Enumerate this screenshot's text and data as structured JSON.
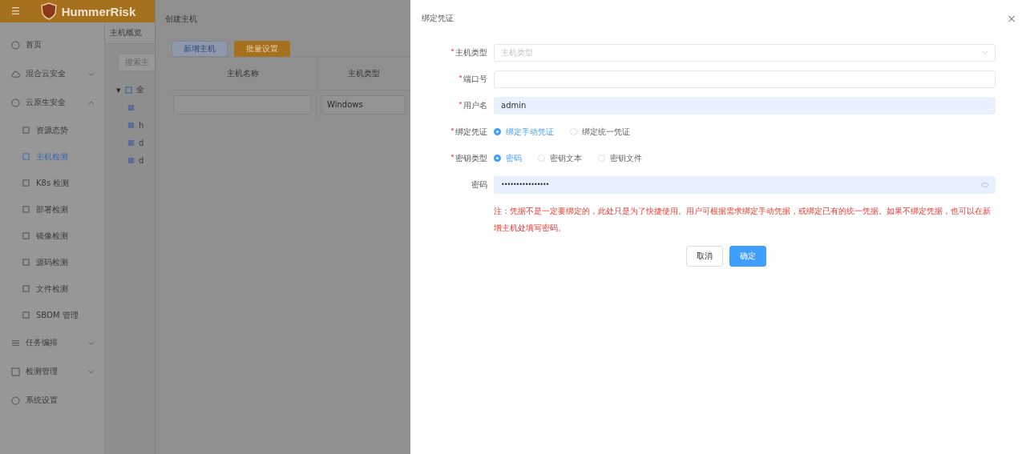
{
  "header": {
    "brand": "HummerRisk",
    "menu_glyph": "☰"
  },
  "sidebar": {
    "items": [
      {
        "label": "首页",
        "kind": "link"
      },
      {
        "label": "混合云安全",
        "kind": "group",
        "expanded": false
      },
      {
        "label": "云原生安全",
        "kind": "group",
        "expanded": true,
        "children": [
          {
            "label": "资源态势",
            "selected": false
          },
          {
            "label": "主机检测",
            "selected": true
          },
          {
            "label": "K8s 检测",
            "selected": false
          },
          {
            "label": "部署检测",
            "selected": false
          },
          {
            "label": "镜像检测",
            "selected": false
          },
          {
            "label": "源码检测",
            "selected": false
          },
          {
            "label": "文件检测",
            "selected": false
          },
          {
            "label": "SBOM 管理",
            "selected": false
          }
        ]
      },
      {
        "label": "任务编排",
        "kind": "group",
        "expanded": false
      },
      {
        "label": "检测管理",
        "kind": "group",
        "expanded": false
      },
      {
        "label": "系统设置",
        "kind": "link"
      }
    ]
  },
  "page": {
    "tab": "主机概览",
    "search": {
      "placeholder": "搜索主"
    },
    "tree": {
      "caret": "▾",
      "label": "全",
      "children": [
        {
          "kind": "host"
        },
        {
          "kind": "host",
          "label": "h"
        },
        {
          "kind": "host",
          "label": "d"
        },
        {
          "kind": "host",
          "label": "d"
        }
      ]
    }
  },
  "create_drawer": {
    "title": "创建主机",
    "buttons": [
      {
        "label": "新增主机",
        "kind": "plain"
      },
      {
        "label": "批量设置",
        "kind": "warning"
      }
    ],
    "table": {
      "columns": [
        "主机名称",
        "主机类型"
      ],
      "rows": [
        {
          "name": "",
          "type": "Windows"
        }
      ]
    }
  },
  "bind_drawer": {
    "title": "绑定凭证",
    "close": "×",
    "fields": [
      {
        "kind": "select",
        "label": "主机类型",
        "required": true,
        "placeholder": "主机类型"
      },
      {
        "kind": "input",
        "label": "端口号",
        "required": true
      },
      {
        "kind": "input",
        "label": "用户名",
        "required": true,
        "value": "admin",
        "autofilled": true
      },
      {
        "kind": "radio",
        "label": "绑定凭证",
        "required": true,
        "options": [
          {
            "label": "绑定手动凭证",
            "selected": true
          },
          {
            "label": "绑定统一凭证",
            "selected": false
          }
        ]
      },
      {
        "kind": "radio",
        "label": "密钥类型",
        "required": true,
        "options": [
          {
            "label": "密码",
            "selected": true
          },
          {
            "label": "密钥文本",
            "selected": false
          },
          {
            "label": "密钥文件",
            "selected": false
          }
        ]
      },
      {
        "kind": "password",
        "label": "密码",
        "value": "••••••••••••••••",
        "autofilled": true
      }
    ],
    "note": "注：凭据不是一定要绑定的，此处只是为了快捷使用。用户可根据需求绑定手动凭据，或绑定已有的统一凭据。如果不绑定凭据，也可以在新增主机处填写密码。",
    "buttons": [
      {
        "label": "取消",
        "kind": "default"
      },
      {
        "label": "确定",
        "kind": "primary"
      }
    ]
  }
}
